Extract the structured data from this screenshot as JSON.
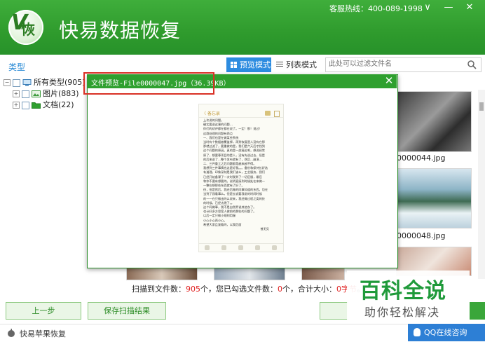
{
  "header": {
    "logo_char": "恢",
    "logo_v": "V",
    "title": "快易数据恢复",
    "hotline": "客服热线：400-089-1998",
    "win_buttons": [
      "∨",
      "—",
      "✕"
    ]
  },
  "toolbar": {
    "type_label": "类型",
    "preview_mode": "预览模式",
    "list_mode": "列表模式",
    "search_placeholder": "此处可以过滤文件名"
  },
  "tree": {
    "items": [
      {
        "expander": "⊟",
        "label": "所有类型(905)",
        "icon": "computer-icon"
      },
      {
        "expander": "⊞",
        "label": "图片(883)",
        "icon": "image-icon"
      },
      {
        "expander": "⊞",
        "label": "文档(22)",
        "icon": "folder-icon"
      }
    ]
  },
  "thumbnails": {
    "labels": [
      "0000044.jpg",
      "0000048.jpg"
    ]
  },
  "status": {
    "prefix": "扫描到文件数：",
    "scanned": "905",
    "mid1": "个，您已勾选文件数：",
    "selected": "0",
    "mid2": "个，合计大小：",
    "size": "0字节",
    "end": "。"
  },
  "buttons": {
    "prev": "上一步",
    "save": "保存扫描结果"
  },
  "footer": {
    "label": "快易苹果恢复",
    "qq": "QQ在线咨询"
  },
  "modal": {
    "title": "文件预览-File0000047.jpg（36.39KB）",
    "close": "✕"
  },
  "phone": {
    "back": "〈 备忘录",
    "lines": [
      "上次说的问题。",
      "确实要说这事的问题…",
      "你们的初评都在都在说了。一定！那！说过！",
      "这群处理的问题有两点",
      "一、我们也是在做某些系统",
      "当时有个数据被覆盖掉，再到恢复是人没有在那",
      "那就过滤了，要重做的是，我们是六天后才找到",
      "这个问题的原因。真的是一部痛苦吧，想说经常",
      "原了，想要尊项目的是人，没有先说过去，但是",
      "的后来说了…整个发布就有了，然后…崩溃…",
      "二、三件重工之后问题都是越来越不得。",
      "我想到三件事情也这是好我。。。备份和保持长好选",
      "有道理，印象深刻是我们该么，工艺服务，我们",
      "已经开始备课了一次时我到了一切后服，最后",
      "和你不要有想要的。说明直接到时候处在来做一",
      "一整在想那些东西就有了好了。",
      "份，但是然后，我还后做的同事知道的东西，包在",
      "当到了我看事么，但是去说要我说的时间时候",
      "的一一在只做出的么说来，我还做过程之类的技",
      "的时候，已经太晚了。。",
      "这个同做事，我不是自然乔说其他东了。",
      "也计好多方思案人做前的那些的问题了。",
      "以后一定只做小规则用服",
      "小心小心再小心。",
      "希望大家且复看的，以我后面"
    ],
    "sign": "曾无见"
  },
  "watermark": {
    "title": "百科全说",
    "sub": "助你轻松解决"
  },
  "colors": {
    "brand_green": "#2f9b2d",
    "accent_blue": "#2d8ce0",
    "highlight_red": "#d93025"
  }
}
